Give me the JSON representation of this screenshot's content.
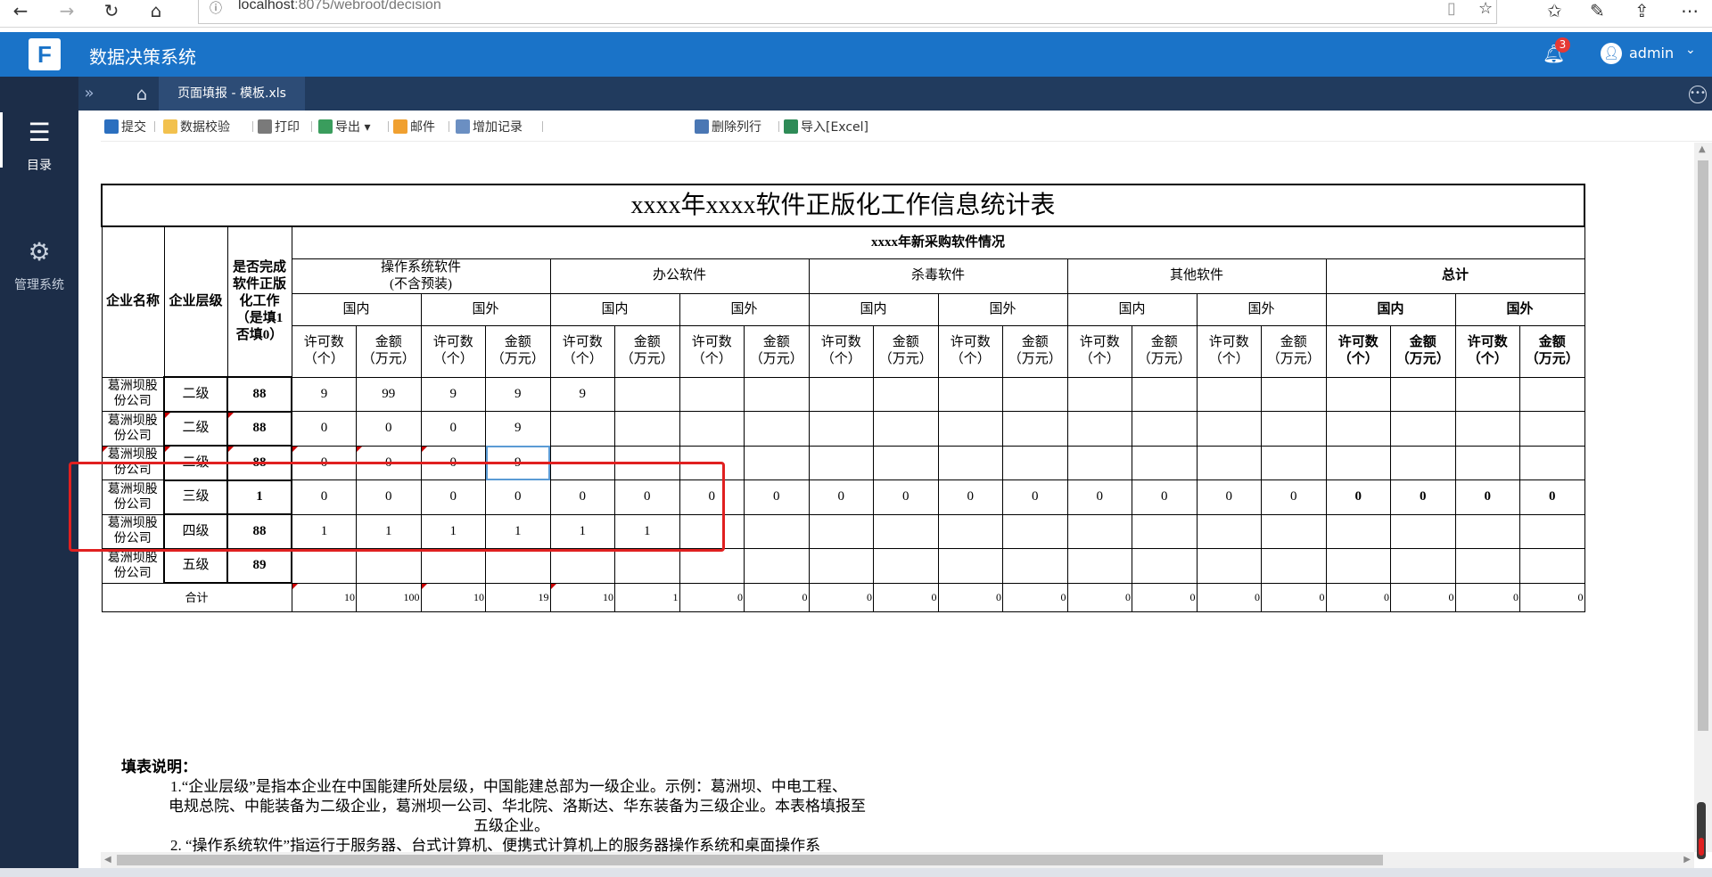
{
  "browser": {
    "url_host": "localhost",
    "url_rest": ":8075/webroot/decision"
  },
  "app": {
    "title": "数据决策系统",
    "notification_count": "3",
    "user": "admin"
  },
  "sidebar": {
    "items": [
      {
        "label": "目录",
        "icon": "catalog-icon"
      },
      {
        "label": "管理系统",
        "icon": "gear-icon"
      }
    ]
  },
  "tabs": {
    "active": "页面填报 - 模板.xls"
  },
  "toolbar": {
    "submit": "提交",
    "validate": "数据校验",
    "print": "打印",
    "export": "导出",
    "mail": "邮件",
    "add_record": "增加记录",
    "delete_row": "删除列行",
    "import": "导入[Excel]"
  },
  "report": {
    "title": "xxxx年xxxx软件正版化工作信息统计表",
    "col_company": "企业名称",
    "col_level": "企业层级",
    "col_complete": "是否完成软件正版化工作（是填1否填0）",
    "col_complete_lines": [
      "是否完成",
      "软件正版",
      "化工作",
      "（是填1",
      "否填0）"
    ],
    "group_title": "xxxx年新采购软件情况",
    "categories": [
      {
        "name": "操作系统软件",
        "sub": "(不含预装)"
      },
      {
        "name": "办公软件",
        "sub": ""
      },
      {
        "name": "杀毒软件",
        "sub": ""
      },
      {
        "name": "其他软件",
        "sub": ""
      },
      {
        "name": "总计",
        "sub": ""
      }
    ],
    "domestic": "国内",
    "foreign": "国外",
    "license_count": [
      "许可数",
      "（个）"
    ],
    "amount": [
      "金额",
      "（万元）"
    ],
    "rows": [
      {
        "company": "葛洲坝股份公司",
        "level": "二级",
        "complete": "88",
        "values": [
          "9",
          "99",
          "9",
          "9",
          "9",
          "",
          "",
          "",
          "",
          "",
          "",
          "",
          "",
          "",
          "",
          "",
          "",
          "",
          "",
          ""
        ]
      },
      {
        "company": "葛洲坝股份公司",
        "level": "二级",
        "complete": "88",
        "values": [
          "0",
          "0",
          "0",
          "9",
          "",
          "",
          "",
          "",
          "",
          "",
          "",
          "",
          "",
          "",
          "",
          "",
          "",
          "",
          "",
          ""
        ]
      },
      {
        "company": "葛洲坝股份公司",
        "level": "二级",
        "complete": "88",
        "values": [
          "0",
          "0",
          "0",
          "9",
          "",
          "",
          "",
          "",
          "",
          "",
          "",
          "",
          "",
          "",
          "",
          "",
          "",
          "",
          "",
          ""
        ]
      },
      {
        "company": "葛洲坝股份公司",
        "level": "三级",
        "complete": "1",
        "values": [
          "0",
          "0",
          "0",
          "0",
          "0",
          "0",
          "0",
          "0",
          "0",
          "0",
          "0",
          "0",
          "0",
          "0",
          "0",
          "0",
          "0",
          "0",
          "0",
          "0"
        ]
      },
      {
        "company": "葛洲坝股份公司",
        "level": "四级",
        "complete": "88",
        "values": [
          "1",
          "1",
          "1",
          "1",
          "1",
          "1",
          "",
          "",
          "",
          "",
          "",
          "",
          "",
          "",
          "",
          "",
          "",
          "",
          "",
          ""
        ]
      },
      {
        "company": "葛洲坝股份公司",
        "level": "五级",
        "complete": "89",
        "values": [
          "",
          "",
          "",
          "",
          "",
          "",
          "",
          "",
          "",
          "",
          "",
          "",
          "",
          "",
          "",
          "",
          "",
          "",
          "",
          ""
        ]
      }
    ],
    "total_label": "合计",
    "totals": [
      "10",
      "100",
      "10",
      "19",
      "10",
      "1",
      "0",
      "0",
      "0",
      "0",
      "0",
      "0",
      "0",
      "0",
      "0",
      "0",
      "0",
      "0",
      "0",
      "0"
    ]
  },
  "notes": {
    "heading": "填表说明：",
    "line1": "1.“企业层级”是指本企业在中国能建所处层级，中国能建总部为一级企业。示例：葛洲坝、中电工程、",
    "line2": "电规总院、中能装备为二级企业，葛洲坝一公司、华北院、洛斯达、华东装备为三级企业。本表格填报至",
    "line3": "五级企业。",
    "line4": "2. “操作系统软件”指运行于服务器、台式计算机、便携式计算机上的服务器操作系统和桌面操作系"
  }
}
